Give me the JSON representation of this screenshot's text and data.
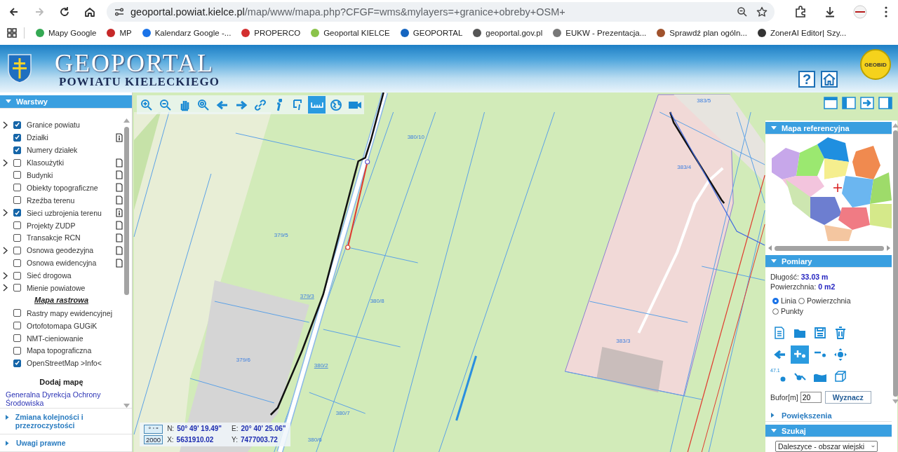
{
  "browser": {
    "nav": [
      {
        "kind": "back",
        "disabled": false
      },
      {
        "kind": "forward",
        "disabled": true
      },
      {
        "kind": "reload",
        "disabled": false
      },
      {
        "kind": "home",
        "disabled": false
      }
    ],
    "url": {
      "host": "geoportal.powiat.kielce.pl",
      "path": "/map/www/mapa.php?CFGF=wms&mylayers=+granice+obreby+OSM+"
    },
    "bookmarks": [
      {
        "label": "Mapy Google",
        "color": "#34a853"
      },
      {
        "label": "MP",
        "color": "#c62828"
      },
      {
        "label": "Kalendarz Google -...",
        "color": "#1a73e8"
      },
      {
        "label": "PROPERCO",
        "color": "#d32f2f"
      },
      {
        "label": "Geoportal KIELCE",
        "color": "#8bc34a"
      },
      {
        "label": "GEOPORTAL",
        "color": "#1565c0"
      },
      {
        "label": "geoportal.gov.pl",
        "color": "#555555"
      },
      {
        "label": "EUKW - Prezentacja...",
        "color": "#777777"
      },
      {
        "label": "Sprawdź plan ogóln...",
        "color": "#a0522d"
      },
      {
        "label": "ZonerAI Editor| Szy...",
        "color": "#333333"
      }
    ]
  },
  "header": {
    "title": "GEOPORTAL",
    "subtitle": "POWIATU KIELECKIEGO",
    "help": "?",
    "logo_text": "GEOBID"
  },
  "layers_panel": {
    "title": "Warstwy",
    "expanded": true,
    "items": [
      {
        "kind": "layer",
        "label": "Granice powiatu",
        "checked": true,
        "expandable": true
      },
      {
        "kind": "layer",
        "label": "Działki",
        "checked": true,
        "expandable": false,
        "legend": {
          "kind": "info"
        }
      },
      {
        "kind": "layer",
        "label": "Numery działek",
        "checked": true,
        "expandable": false
      },
      {
        "kind": "layer",
        "label": "Klasoużytki",
        "checked": false,
        "expandable": true,
        "legend": {
          "kind": "page"
        }
      },
      {
        "kind": "layer",
        "label": "Budynki",
        "checked": false,
        "expandable": false,
        "legend": {
          "kind": "page"
        }
      },
      {
        "kind": "layer",
        "label": "Obiekty topograficzne",
        "checked": false,
        "expandable": false,
        "legend": {
          "kind": "page"
        }
      },
      {
        "kind": "layer",
        "label": "Rzeźba terenu",
        "checked": false,
        "expandable": false,
        "legend": {
          "kind": "page"
        }
      },
      {
        "kind": "layer",
        "label": "Sieci uzbrojenia terenu",
        "checked": true,
        "expandable": true,
        "legend": {
          "kind": "info"
        }
      },
      {
        "kind": "layer",
        "label": "Projekty ZUDP",
        "checked": false,
        "expandable": false,
        "legend": {
          "kind": "page"
        }
      },
      {
        "kind": "layer",
        "label": "Transakcje RCN",
        "checked": false,
        "expandable": false,
        "legend": {
          "kind": "page"
        }
      },
      {
        "kind": "layer",
        "label": "Osnowa geodezyjna",
        "checked": false,
        "expandable": true,
        "legend": {
          "kind": "page"
        }
      },
      {
        "kind": "layer",
        "label": "Osnowa ewidencyjna",
        "checked": false,
        "expandable": false,
        "legend": {
          "kind": "page"
        }
      },
      {
        "kind": "layer",
        "label": "Sieć drogowa",
        "checked": false,
        "expandable": true
      },
      {
        "kind": "layer",
        "label": "Mienie powiatowe",
        "checked": false,
        "expandable": true
      },
      {
        "kind": "heading",
        "label": "Mapa rastrowa"
      },
      {
        "kind": "layer",
        "label": "Rastry mapy ewidencyjnej",
        "checked": false,
        "expandable": false
      },
      {
        "kind": "layer",
        "label": "Ortofotomapa GUGiK",
        "checked": false,
        "expandable": false
      },
      {
        "kind": "layer",
        "label": "NMT-cieniowanie",
        "checked": false,
        "expandable": false
      },
      {
        "kind": "layer",
        "label": "Mapa topograficzna",
        "checked": false,
        "expandable": false
      },
      {
        "kind": "layer",
        "label": "OpenStreetMap >Info<",
        "checked": true,
        "expandable": false
      }
    ],
    "add_map": {
      "title": "Dodaj mapę",
      "link": "Generalna Dyrekcja Ochrony Środowiska"
    }
  },
  "left_sections": [
    {
      "title": "Zmiana kolejności i przezroczystości",
      "expanded": false
    },
    {
      "title": "Uwagi prawne",
      "expanded": false
    }
  ],
  "map": {
    "tools": [
      {
        "kind": "zoomin",
        "selected": false
      },
      {
        "kind": "zoomout",
        "selected": false
      },
      {
        "kind": "pan",
        "selected": false
      },
      {
        "kind": "zoomall",
        "selected": false
      },
      {
        "kind": "back",
        "selected": false
      },
      {
        "kind": "forward",
        "selected": false
      },
      {
        "kind": "link",
        "selected": false
      },
      {
        "kind": "info",
        "selected": false
      },
      {
        "kind": "query",
        "selected": false
      },
      {
        "kind": "measure",
        "selected": true
      },
      {
        "kind": "globe",
        "selected": false
      },
      {
        "kind": "camera",
        "selected": false
      }
    ],
    "parcels": [
      {
        "label": "380/10",
        "underlined": false
      },
      {
        "label": "379/5",
        "underlined": false
      },
      {
        "label": "379/3",
        "underlined": true
      },
      {
        "label": "380/8",
        "underlined": false
      },
      {
        "label": "379/6",
        "underlined": false
      },
      {
        "label": "380/2",
        "underlined": true
      },
      {
        "label": "380/7",
        "underlined": false
      },
      {
        "label": "380/6",
        "underlined": false
      },
      {
        "label": "383/4",
        "underlined": false
      },
      {
        "label": "383/3",
        "underlined": false
      },
      {
        "label": "383/5",
        "underlined": false
      }
    ],
    "coordinates": {
      "format_button": "° ' \"",
      "system_button": "2000",
      "rows": [
        {
          "label": "N:",
          "value": "50° 49' 19.49\""
        },
        {
          "label": "E:",
          "value": "20° 40' 25.06\""
        },
        {
          "label": "X:",
          "value": "5631910.02"
        },
        {
          "label": "Y:",
          "value": "7477003.72"
        }
      ]
    }
  },
  "reference_map": {
    "title": "Mapa referencyjna",
    "expanded": true
  },
  "measurements": {
    "title": "Pomiary",
    "expanded": true,
    "length_label": "Długość:",
    "length": "33.03 m",
    "area_label": "Powierzchnia:",
    "area": "0 m2",
    "modes": [
      {
        "label": "Linia",
        "selected": true
      },
      {
        "label": "Powierzchnia",
        "selected": false
      },
      {
        "label": "Punkty",
        "selected": false
      }
    ],
    "tools": [
      {
        "kind": "new",
        "selected": false
      },
      {
        "kind": "open",
        "selected": false
      },
      {
        "kind": "save",
        "selected": false
      },
      {
        "kind": "delete",
        "selected": false
      },
      {
        "kind": "undo",
        "selected": false
      },
      {
        "kind": "addpoint",
        "selected": true
      },
      {
        "kind": "removepoint",
        "selected": false
      },
      {
        "kind": "move",
        "selected": false
      },
      {
        "kind": "label",
        "selected": false,
        "caption": "47.1"
      },
      {
        "kind": "vertex",
        "selected": false
      },
      {
        "kind": "profile",
        "selected": false
      },
      {
        "kind": "volume",
        "selected": false
      }
    ],
    "buffer_label": "Bufor[m]",
    "buffer": "20",
    "button": "Wyznacz"
  },
  "zoom_section": {
    "title": "Powiększenia",
    "expanded": false
  },
  "search": {
    "title": "Szukaj",
    "expanded": true,
    "area": "Daleszyce - obszar wiejski"
  }
}
